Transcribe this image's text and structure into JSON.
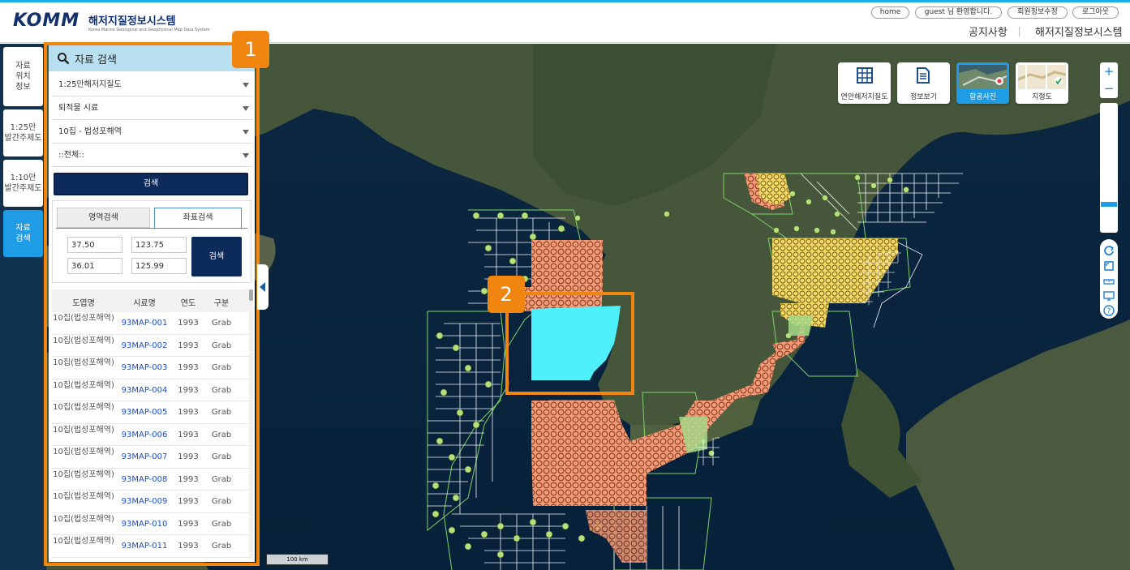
{
  "header": {
    "brand": "KOMM",
    "system_name": "해저지질정보시스템",
    "system_subtitle": "Korea Marine Geological and Geophysical Map Data System",
    "buttons": [
      "home",
      "guest 님 환영합니다.",
      "회원정보수정",
      "로그아웃"
    ],
    "gnb": [
      "공지사항",
      "해저지질정보시스템"
    ]
  },
  "leftnav": {
    "items": [
      {
        "label": "자료\n위치\n정보",
        "active": false
      },
      {
        "label": "1:25만\n발간주제도",
        "active": false
      },
      {
        "label": "1:10만\n발간주제도",
        "active": false
      },
      {
        "label": "자료\n검색",
        "active": true
      }
    ]
  },
  "panel": {
    "title": "자료 검색",
    "selects": [
      "1:25만해저지질도",
      "퇴적물 시료",
      "10집 - 법성포해역",
      "::전체::"
    ],
    "search_button": "검색",
    "tabs": [
      "영역검색",
      "좌표검색"
    ],
    "active_tab": "좌표검색",
    "coords": {
      "lat_max": "37.50",
      "lon_min": "123.75",
      "lat_min": "36.01",
      "lon_max": "125.99"
    },
    "coord_search_button": "검색",
    "table": {
      "headers": [
        "도엽명",
        "시료명",
        "연도",
        "구분"
      ],
      "rows": [
        [
          "10집(법성포해역)",
          "93MAP-001",
          "1993",
          "Grab"
        ],
        [
          "10집(법성포해역)",
          "93MAP-002",
          "1993",
          "Grab"
        ],
        [
          "10집(법성포해역)",
          "93MAP-003",
          "1993",
          "Grab"
        ],
        [
          "10집(법성포해역)",
          "93MAP-004",
          "1993",
          "Grab"
        ],
        [
          "10집(법성포해역)",
          "93MAP-005",
          "1993",
          "Grab"
        ],
        [
          "10집(법성포해역)",
          "93MAP-006",
          "1993",
          "Grab"
        ],
        [
          "10집(법성포해역)",
          "93MAP-007",
          "1993",
          "Grab"
        ],
        [
          "10집(법성포해역)",
          "93MAP-008",
          "1993",
          "Grab"
        ],
        [
          "10집(법성포해역)",
          "93MAP-009",
          "1993",
          "Grab"
        ],
        [
          "10집(법성포해역)",
          "93MAP-010",
          "1993",
          "Grab"
        ],
        [
          "10집(법성포해역)",
          "93MAP-011",
          "1993",
          "Grab"
        ]
      ]
    }
  },
  "map_buttons": [
    {
      "label": "연안해저지질도",
      "icon": "grid-icon",
      "active": false
    },
    {
      "label": "정보보기",
      "icon": "document-icon",
      "active": false
    },
    {
      "label": "항공사진",
      "icon": "aerial-photo-icon",
      "active": true
    },
    {
      "label": "지형도",
      "icon": "terrain-map-icon",
      "active": false
    }
  ],
  "zoom": {
    "in": "+",
    "out": "−"
  },
  "scale_label": "100 km",
  "annotations": {
    "badge1": "1",
    "badge2": "2"
  },
  "colors": {
    "highlight": "#f0850f",
    "nav_bg": "#11324f",
    "nav_active": "#1e9ce6",
    "search_btn": "#0d2b5a",
    "panel_title": "#b8dff0",
    "selection_fill": "#4df0fb",
    "sample_salmon": "#f49a78",
    "sample_yellow": "#f6d866",
    "track_green": "#b6e07a"
  }
}
